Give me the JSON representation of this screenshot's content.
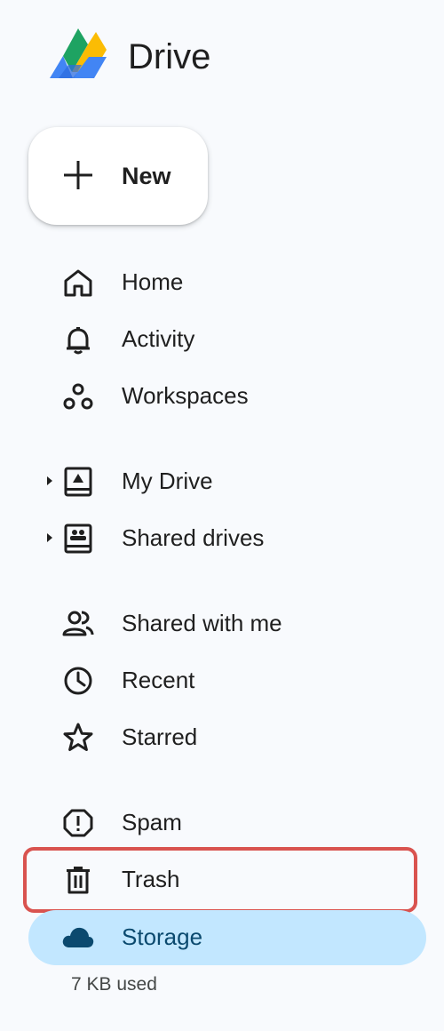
{
  "app": {
    "title": "Drive"
  },
  "new_button": {
    "label": "New"
  },
  "nav": {
    "home": "Home",
    "activity": "Activity",
    "workspaces": "Workspaces",
    "my_drive": "My Drive",
    "shared_drives": "Shared drives",
    "shared_with_me": "Shared with me",
    "recent": "Recent",
    "starred": "Starred",
    "spam": "Spam",
    "trash": "Trash",
    "storage": "Storage"
  },
  "storage": {
    "used_text": "7 KB used"
  },
  "colors": {
    "background": "#f8fafd",
    "selected_bg": "#c2e7ff",
    "selected_text": "#0b4a6f",
    "highlight_border": "#d9534f",
    "icon": "#1f1f1f"
  },
  "icons": {
    "logo": "google-drive-logo",
    "new": "plus-icon",
    "home": "home-icon",
    "activity": "bell-icon",
    "workspaces": "workspaces-icon",
    "my_drive": "my-drive-icon",
    "shared_drives": "shared-drives-icon",
    "shared_with_me": "people-icon",
    "recent": "clock-icon",
    "starred": "star-icon",
    "spam": "spam-icon",
    "trash": "trash-icon",
    "storage": "cloud-icon"
  }
}
